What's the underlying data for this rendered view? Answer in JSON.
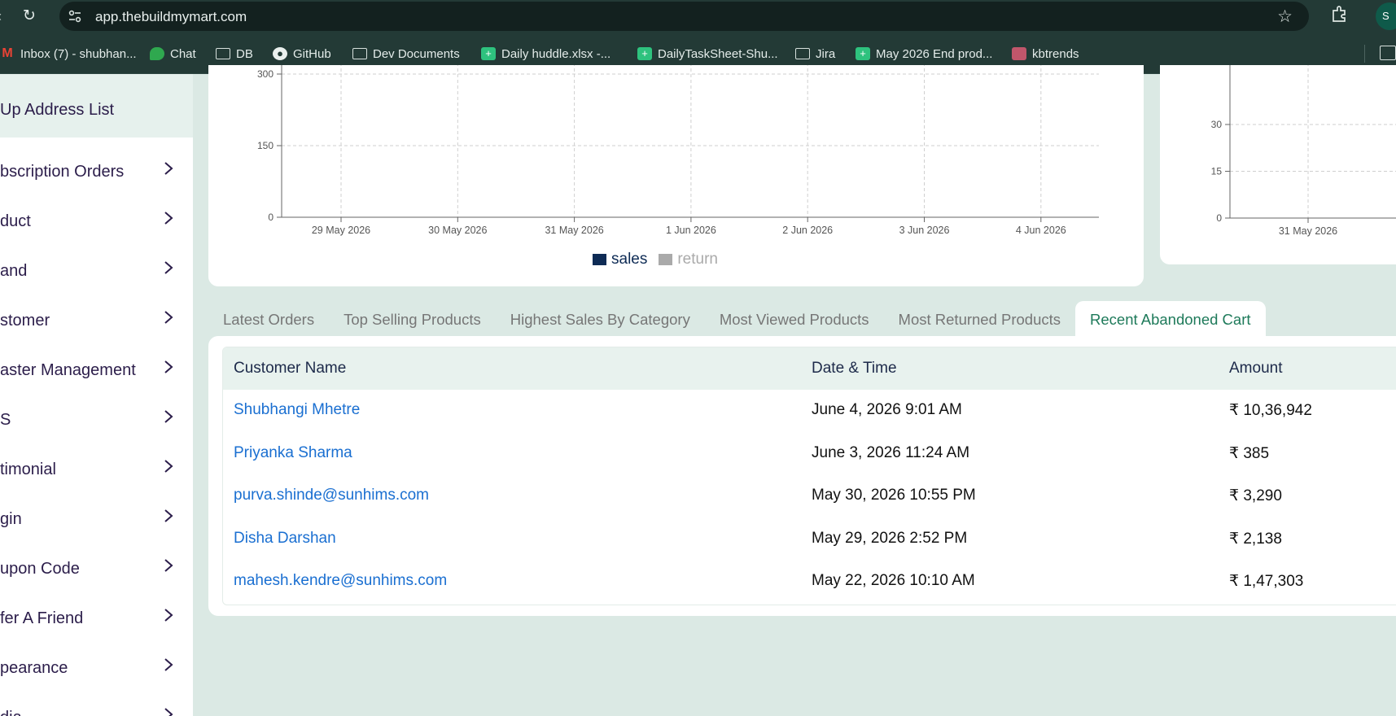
{
  "browser": {
    "url": "app.thebuildmymart.com",
    "profile_initial": "S",
    "bookmarks": [
      {
        "label": "Inbox (7) - shubhan...",
        "icon": "gmail-icon"
      },
      {
        "label": "Chat",
        "icon": "chat-icon"
      },
      {
        "label": "DB",
        "icon": "folder-icon"
      },
      {
        "label": "GitHub",
        "icon": "github-icon"
      },
      {
        "label": "Dev Documents",
        "icon": "folder-icon"
      },
      {
        "label": "Daily huddle.xlsx -...",
        "icon": "sheets-icon"
      },
      {
        "label": "DailyTaskSheet-Shu...",
        "icon": "sheets-icon"
      },
      {
        "label": "Jira",
        "icon": "folder-icon"
      },
      {
        "label": "May 2026 End prod...",
        "icon": "sheets-icon"
      },
      {
        "label": "kbtrends",
        "icon": "kbtrends-icon"
      }
    ]
  },
  "sidebar": {
    "active_item": "Up Address List",
    "items": [
      {
        "label": "bscription Orders"
      },
      {
        "label": "duct"
      },
      {
        "label": "and"
      },
      {
        "label": "stomer"
      },
      {
        "label": "aster Management"
      },
      {
        "label": "S"
      },
      {
        "label": "timonial"
      },
      {
        "label": "gin"
      },
      {
        "label": "upon Code"
      },
      {
        "label": "fer A Friend"
      },
      {
        "label": "pearance"
      },
      {
        "label": "dia"
      }
    ]
  },
  "chart_data": [
    {
      "type": "bar",
      "title": "",
      "xlabel": "",
      "ylabel": "",
      "categories": [
        "29 May 2026",
        "30 May 2026",
        "31 May 2026",
        "1 Jun 2026",
        "2 Jun 2026",
        "3 Jun 2026",
        "4 Jun 2026"
      ],
      "y_ticks": [
        0,
        150,
        300
      ],
      "y_ticks_visible": [
        "0",
        "150"
      ],
      "ylim": [
        0,
        300
      ],
      "grid": true,
      "legend_position": "bottom",
      "series": [
        {
          "name": "sales",
          "values": [
            0,
            0,
            0,
            0,
            0,
            0,
            0
          ],
          "color": "#0e2b55"
        },
        {
          "name": "return",
          "values": [
            0,
            0,
            0,
            0,
            0,
            0,
            0
          ],
          "color": "#aaaaaa"
        }
      ]
    },
    {
      "type": "bar",
      "title": "",
      "xlabel": "",
      "ylabel": "",
      "categories": [
        "31 May 2026"
      ],
      "y_ticks": [
        0,
        15,
        30
      ],
      "ylim": [
        0,
        45
      ],
      "grid": true,
      "series": []
    }
  ],
  "tabs": {
    "items": [
      {
        "label": "Latest Orders"
      },
      {
        "label": "Top Selling Products"
      },
      {
        "label": "Highest Sales By Category"
      },
      {
        "label": "Most Viewed Products"
      },
      {
        "label": "Most Returned Products"
      },
      {
        "label": "Recent Abandoned Cart"
      }
    ],
    "active": "Recent Abandoned Cart"
  },
  "table": {
    "columns": [
      "Customer Name",
      "Date & Time",
      "Amount"
    ],
    "rows": [
      {
        "customer": "Shubhangi Mhetre",
        "datetime": "June 4, 2026 9:01 AM",
        "amount": "₹ 10,36,942"
      },
      {
        "customer": "Priyanka Sharma",
        "datetime": "June 3, 2026 11:24 AM",
        "amount": "₹ 385"
      },
      {
        "customer": "purva.shinde@sunhims.com",
        "datetime": "May 30, 2026 10:55 PM",
        "amount": "₹ 3,290"
      },
      {
        "customer": "Disha Darshan",
        "datetime": "May 29, 2026 2:52 PM",
        "amount": "₹ 2,138"
      },
      {
        "customer": "mahesh.kendre@sunhims.com",
        "datetime": "May 22, 2026 10:10 AM",
        "amount": "₹ 1,47,303"
      }
    ]
  }
}
